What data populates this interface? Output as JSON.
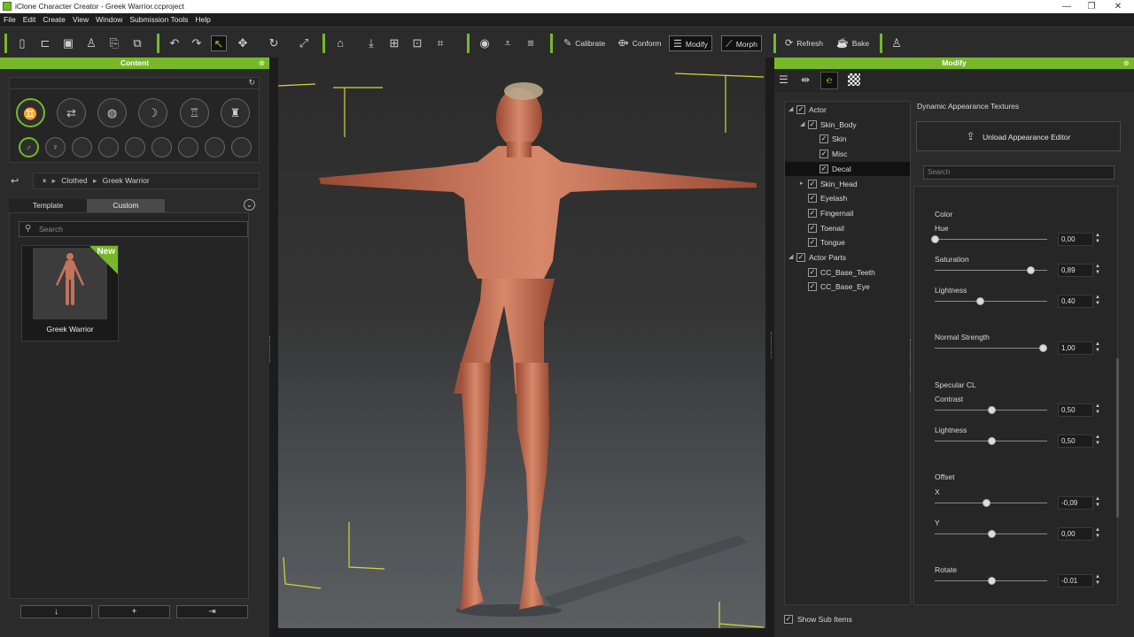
{
  "window": {
    "title": "iClone Character Creator - Greek Warrior.ccproject",
    "minimize": "—",
    "restore": "❐",
    "close": "✕"
  },
  "menu": [
    "File",
    "Edit",
    "Create",
    "View",
    "Window",
    "Submission Tools",
    "Help"
  ],
  "toolbar": {
    "calibrate": "Calibrate",
    "conform": "Conform",
    "modify": "Modify",
    "morph": "Morph",
    "refresh": "Refresh",
    "bake": "Bake"
  },
  "content_panel": {
    "title": "Content",
    "breadcrumb": [
      "Clothed",
      "Greek Warrior"
    ],
    "tabs": [
      "Template",
      "Custom"
    ],
    "active_tab": "Custom",
    "search_placeholder": "Search",
    "items": [
      {
        "label": "Greek Warrior",
        "badge": "New"
      }
    ],
    "bottom_buttons": [
      "↓",
      "+",
      "⇥"
    ]
  },
  "modify_panel": {
    "title": "Modify",
    "tree": [
      {
        "label": "Actor",
        "checked": true,
        "level": 0,
        "expanded": true
      },
      {
        "label": "Skin_Body",
        "checked": true,
        "level": 1,
        "expanded": true
      },
      {
        "label": "Skin",
        "checked": true,
        "level": 2
      },
      {
        "label": "Misc",
        "checked": true,
        "level": 2
      },
      {
        "label": "Decal",
        "checked": true,
        "level": 2,
        "selected": true
      },
      {
        "label": "Skin_Head",
        "checked": true,
        "level": 1,
        "expanded": false
      },
      {
        "label": "Eyelash",
        "checked": true,
        "level": 1
      },
      {
        "label": "Fingernail",
        "checked": true,
        "level": 1
      },
      {
        "label": "Toenail",
        "checked": true,
        "level": 1
      },
      {
        "label": "Tongue",
        "checked": true,
        "level": 1
      },
      {
        "label": "Actor Parts",
        "checked": true,
        "level": 0,
        "expanded": true
      },
      {
        "label": "CC_Base_Teeth",
        "checked": true,
        "level": 1
      },
      {
        "label": "CC_Base_Eye",
        "checked": true,
        "level": 1
      }
    ],
    "section_title": "Dynamic Appearance Textures",
    "unload_button": "Unload Appearance Editor",
    "search_placeholder": "Search",
    "groups": {
      "color": "Color",
      "specular": "Specular CL",
      "offset": "Offset"
    },
    "sliders": {
      "hue": {
        "label": "Hue",
        "value": "0,00",
        "fraction": 0.0
      },
      "saturation": {
        "label": "Saturation",
        "value": "0,89",
        "fraction": 0.85
      },
      "lightness": {
        "label": "Lightness",
        "value": "0,40",
        "fraction": 0.4
      },
      "normal_strength": {
        "label": "Normal Strength",
        "value": "1,00",
        "fraction": 0.96
      },
      "contrast": {
        "label": "Contrast",
        "value": "0,50",
        "fraction": 0.5
      },
      "spec_lightness": {
        "label": "Lightness",
        "value": "0,50",
        "fraction": 0.5
      },
      "offset_x": {
        "label": "X",
        "value": "-0,09",
        "fraction": 0.46
      },
      "offset_y": {
        "label": "Y",
        "value": "0,00",
        "fraction": 0.5
      },
      "rotate": {
        "label": "Rotate",
        "value": "-0.01",
        "fraction": 0.5
      }
    },
    "show_sub_items": "Show Sub Items"
  },
  "colors": {
    "accent": "#76b82a",
    "panel_bg": "#2b2b2b"
  }
}
